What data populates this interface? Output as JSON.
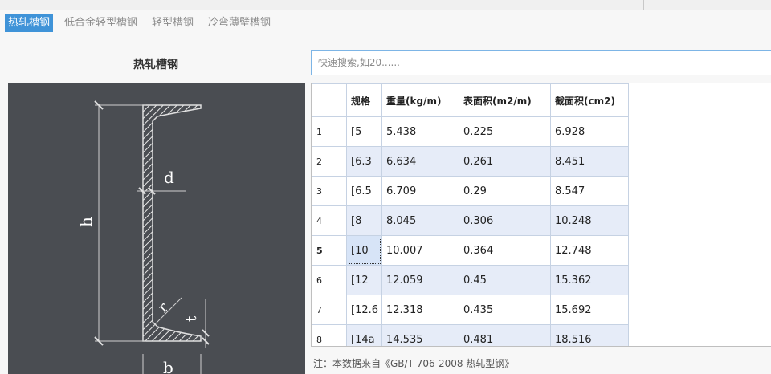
{
  "tabs": [
    {
      "label": "热轧槽钢",
      "active": true
    },
    {
      "label": "低合金轻型槽钢",
      "active": false
    },
    {
      "label": "轻型槽钢",
      "active": false
    },
    {
      "label": "冷弯薄壁槽钢",
      "active": false
    }
  ],
  "left_panel": {
    "title": "热轧槽钢",
    "diagram_labels": {
      "h": "h",
      "d": "d",
      "r": "r",
      "t": "t",
      "b": "b"
    }
  },
  "search": {
    "placeholder": "快速搜索,如20......",
    "value": ""
  },
  "table": {
    "headers": [
      "",
      "规格",
      "重量(kg/m)",
      "表面积(m2/m)",
      "截面积(cm2)"
    ],
    "rows": [
      {
        "n": "1",
        "spec": "[5",
        "weight": "5.438",
        "surface": "0.225",
        "section": "6.928"
      },
      {
        "n": "2",
        "spec": "[6.3",
        "weight": "6.634",
        "surface": "0.261",
        "section": "8.451"
      },
      {
        "n": "3",
        "spec": "[6.5",
        "weight": "6.709",
        "surface": "0.29",
        "section": "8.547"
      },
      {
        "n": "4",
        "spec": "[8",
        "weight": "8.045",
        "surface": "0.306",
        "section": "10.248"
      },
      {
        "n": "5",
        "spec": "[10",
        "weight": "10.007",
        "surface": "0.364",
        "section": "12.748"
      },
      {
        "n": "6",
        "spec": "[12",
        "weight": "12.059",
        "surface": "0.45",
        "section": "15.362"
      },
      {
        "n": "7",
        "spec": "[12.6",
        "weight": "12.318",
        "surface": "0.435",
        "section": "15.692"
      },
      {
        "n": "8",
        "spec": "[14a",
        "weight": "14.535",
        "surface": "0.481",
        "section": "18.516"
      }
    ],
    "selected_row": 5
  },
  "note": "注：本数据来自《GB/T  706-2008 热轧型钢》",
  "colors": {
    "accent": "#3f93d8",
    "diagram_bg": "#4a4d52",
    "row_alt": "#e6ecf8"
  }
}
